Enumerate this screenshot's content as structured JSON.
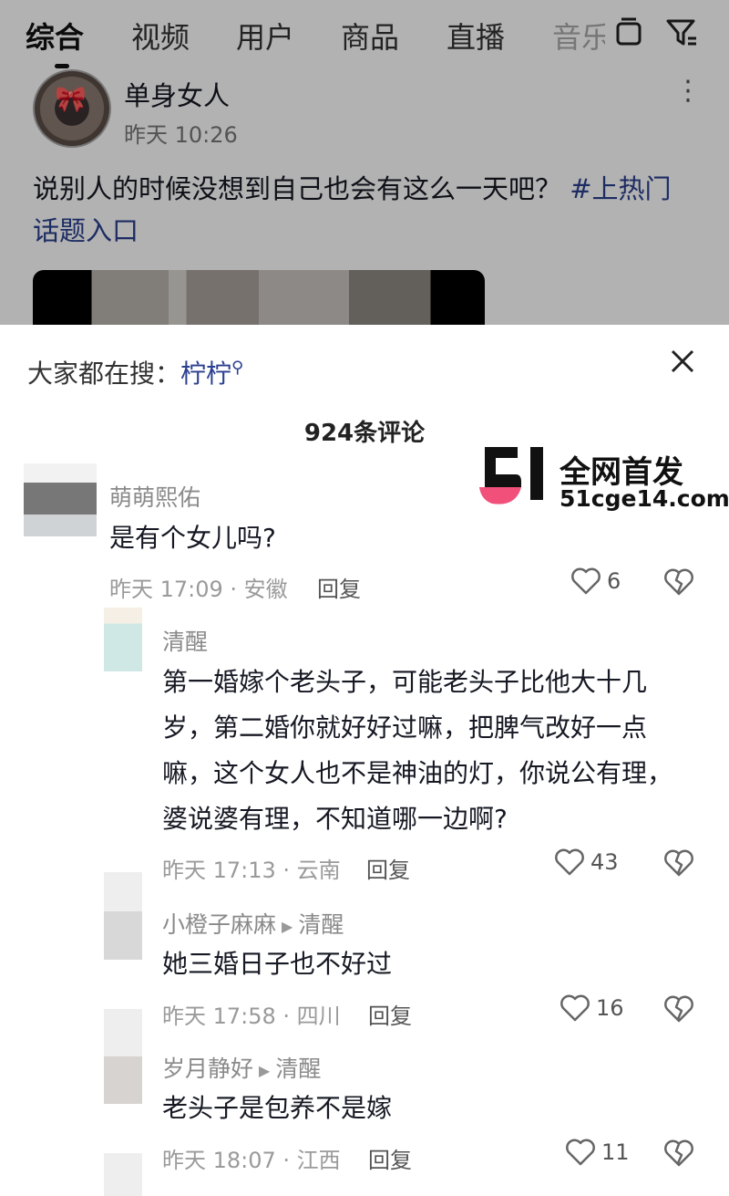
{
  "tabs": [
    "综合",
    "视频",
    "用户",
    "商品",
    "直播",
    "音乐"
  ],
  "post": {
    "author": "单身女人",
    "time": "昨天 10:26",
    "text": "说别人的时候没想到自己也会有这么一天吧？",
    "hashtag": "#上热门话题入口"
  },
  "search_hint": {
    "label": "大家都在搜：",
    "term": "柠柠"
  },
  "comment_count": "924条评论",
  "watermark": {
    "line1": "全网首发",
    "line2": "51cge14.com"
  },
  "comments": [
    {
      "user": "萌萌熙佑",
      "text": "是有个女儿吗?",
      "meta": "昨天 17:09 · 安徽",
      "reply": "回复",
      "likes": "6"
    },
    {
      "user": "清醒",
      "text": "第一婚嫁个老头子，可能老头子比他大十几岁，第二婚你就好好过嘛，把脾气改好一点嘛，这个女人也不是神油的灯，你说公有理，婆说婆有理，不知道哪一边啊?",
      "meta": "昨天 17:13 · 云南",
      "reply": "回复",
      "likes": "43"
    },
    {
      "user": "小橙子麻麻",
      "reply_to": "清醒",
      "text": "她三婚日子也不好过",
      "meta": "昨天 17:58 · 四川",
      "reply": "回复",
      "likes": "16"
    },
    {
      "user": "岁月静好",
      "reply_to": "清醒",
      "text": "老头子是包养不是嫁",
      "meta": "昨天 18:07 · 江西",
      "reply": "回复",
      "likes": "11"
    }
  ],
  "colors": {
    "accent": "#2a3f8f",
    "logo_pink": "#f0507a"
  }
}
